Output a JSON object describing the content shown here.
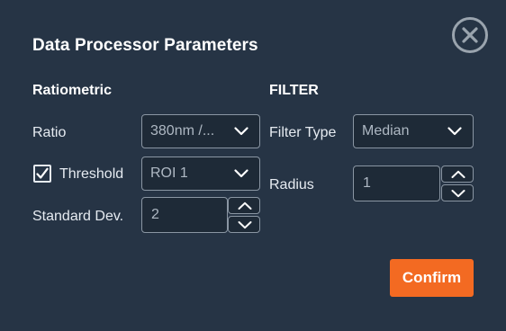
{
  "dialog": {
    "title": "Data Processor Parameters",
    "close_icon": "close-circle-icon"
  },
  "ratiometric": {
    "heading": "Ratiometric",
    "ratio": {
      "label": "Ratio",
      "selected": "380nm /..."
    },
    "threshold": {
      "label": "Threshold",
      "checked": true,
      "selected": "ROI 1"
    },
    "std_dev": {
      "label": "Standard Dev.",
      "value": "2"
    }
  },
  "filter": {
    "heading": "FILTER",
    "filter_type": {
      "label": "Filter Type",
      "selected": "Median"
    },
    "radius": {
      "label": "Radius",
      "value": "1"
    }
  },
  "actions": {
    "confirm_label": "Confirm"
  },
  "colors": {
    "background": "#263445",
    "field_bg": "#1e2a37",
    "field_border": "#8a96a3",
    "accent": "#f36a22"
  }
}
